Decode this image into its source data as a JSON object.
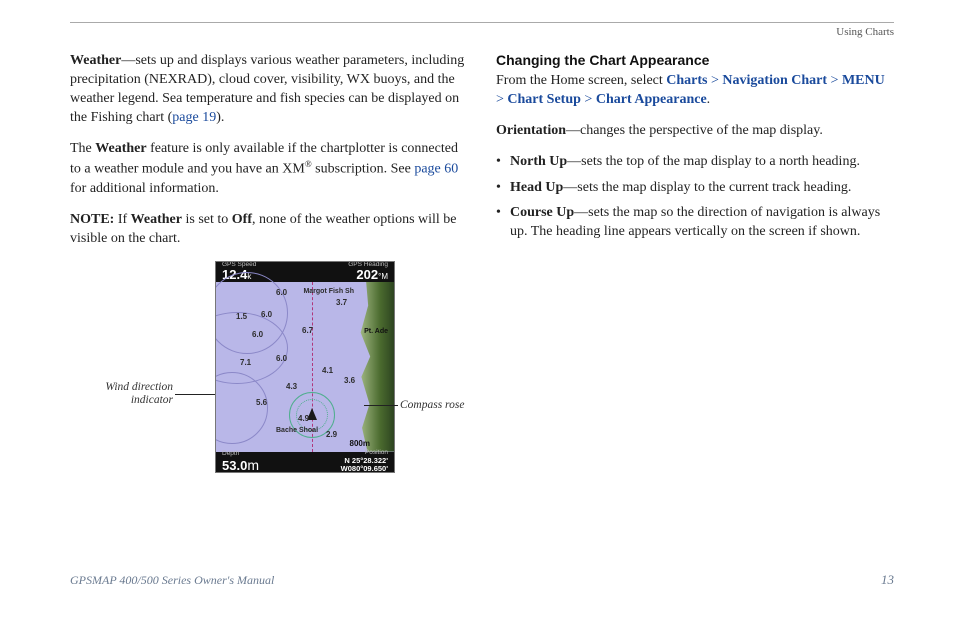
{
  "header": {
    "section_label": "Using Charts"
  },
  "left": {
    "p1_lead": "Weather",
    "p1_rest": "—sets up and displays various weather parameters, including precipitation (NEXRAD), cloud cover, visibility, WX buoys, and the weather legend. Sea temperature and fish species can be displayed on the Fishing chart (",
    "p1_link": "page 19",
    "p1_close": ").",
    "p2_pre": "The ",
    "p2_bold": "Weather",
    "p2_rest": " feature is only available if the chartplotter is connected to a weather module and you have an XM",
    "p2_reg": "®",
    "p2_rest2": " subscription. See ",
    "p2_link": "page 60",
    "p2_rest3": " for additional information.",
    "p3_note": "NOTE:",
    "p3_a": " If ",
    "p3_bold1": "Weather",
    "p3_b": " is set to ",
    "p3_bold2": "Off",
    "p3_c": ", none of the weather options will be visible on the chart.",
    "callout_wind1": "Wind direction",
    "callout_wind2": "indicator",
    "callout_rose": "Compass rose"
  },
  "gps": {
    "tl_label": "GPS Speed",
    "tl_value": "12.4",
    "tl_unit": "k",
    "tr_label": "GPS Heading",
    "tr_value": "202",
    "tr_unit": "°M",
    "bl_label": "Depth",
    "bl_value": "53.0",
    "bl_unit": "m",
    "br_label": "Position",
    "br_line1": "N  25°28.322'",
    "br_line2": "W080°09.650'",
    "scale": "800m",
    "poi_margot": "Margot Fish Sh",
    "poi_adams": "Pt. Ade",
    "poi_bache": "Bache Shoal",
    "depths": {
      "d1": "1.5",
      "d2": "6.0",
      "d3": "6.0",
      "d4": "6.7",
      "d5": "6.0",
      "d6": "3.7",
      "d7": "7.1",
      "d8": "6.0",
      "d9": "4.1",
      "d10": "4.3",
      "d11": "5.6",
      "d12": "4.9",
      "d13": "2.9",
      "d14": "3.6"
    }
  },
  "right": {
    "heading": "Changing the Chart Appearance",
    "path_intro": "From the Home screen, select ",
    "path_p1": "Charts",
    "path_p2": "Navigation Chart",
    "path_p3": "MENU",
    "path_p4": "Chart Setup",
    "path_p5": "Chart Appearance",
    "path_end": ".",
    "sep": " > ",
    "orient_lead": "Orientation",
    "orient_rest": "—changes the perspective of the map display.",
    "li1_lead": "North Up",
    "li1_rest": "—sets the top of the map display to a north heading.",
    "li2_lead": "Head Up",
    "li2_rest": "—sets the map display to the current track heading.",
    "li3_lead": "Course Up",
    "li3_rest": "—sets the map so the direction of navigation is always up. The heading line appears vertically on the screen if shown."
  },
  "footer": {
    "manual": "GPSMAP 400/500 Series Owner's Manual",
    "page": "13"
  }
}
